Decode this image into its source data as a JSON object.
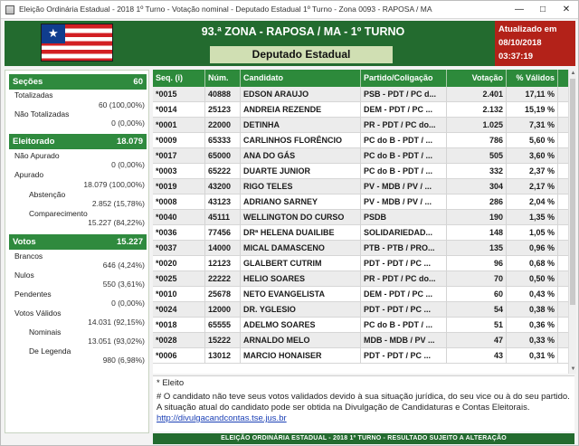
{
  "window": {
    "title": "Eleição Ordinária Estadual - 2018 1º Turno - Votação nominal - Deputado Estadual 1º Turno - Zona 0093 - RAPOSA / MA"
  },
  "header": {
    "title": "93.ª ZONA - RAPOSA / MA - 1º TURNO",
    "subtitle": "Deputado Estadual",
    "updated_label": "Atualizado em",
    "updated_date": "08/10/2018",
    "updated_time": "03:37:19"
  },
  "sidebar": {
    "secoes": {
      "label": "Seções",
      "total": "60",
      "totalizadas_label": "Totalizadas",
      "totalizadas_value": "60 (100,00%)",
      "nao_totalizadas_label": "Não Totalizadas",
      "nao_totalizadas_value": "0 (0,00%)"
    },
    "eleitorado": {
      "label": "Eleitorado",
      "total": "18.079",
      "nao_apurado_label": "Não Apurado",
      "nao_apurado_value": "0 (0,00%)",
      "apurado_label": "Apurado",
      "apurado_value": "18.079 (100,00%)",
      "abstencao_label": "Abstenção",
      "abstencao_value": "2.852 (15,78%)",
      "comparecimento_label": "Comparecimento",
      "comparecimento_value": "15.227 (84,22%)"
    },
    "votos": {
      "label": "Votos",
      "total": "15.227",
      "brancos_label": "Brancos",
      "brancos_value": "646 (4,24%)",
      "nulos_label": "Nulos",
      "nulos_value": "550 (3,61%)",
      "pendentes_label": "Pendentes",
      "pendentes_value": "0 (0,00%)",
      "validos_label": "Votos Válidos",
      "validos_value": "14.031 (92,15%)",
      "nominais_label": "Nominais",
      "nominais_value": "13.051 (93,02%)",
      "legenda_label": "De Legenda",
      "legenda_value": "980 (6,98%)"
    }
  },
  "table": {
    "headers": {
      "seq": "Seq. (i)",
      "num": "Núm.",
      "cand": "Candidato",
      "part": "Partido/Coligação",
      "vot": "Votação",
      "pct": "% Válidos"
    },
    "rows": [
      {
        "seq": "*0015",
        "num": "40888",
        "cand": "EDSON ARAUJO",
        "part": "PSB - PDT / PC d...",
        "vot": "2.401",
        "pct": "17,11 %"
      },
      {
        "seq": "*0014",
        "num": "25123",
        "cand": "ANDREIA REZENDE",
        "part": "DEM - PDT / PC ...",
        "vot": "2.132",
        "pct": "15,19 %"
      },
      {
        "seq": "*0001",
        "num": "22000",
        "cand": "DETINHA",
        "part": "PR - PDT / PC do...",
        "vot": "1.025",
        "pct": "7,31 %"
      },
      {
        "seq": "*0009",
        "num": "65333",
        "cand": "CARLINHOS FLORÊNCIO",
        "part": "PC do B - PDT / ...",
        "vot": "786",
        "pct": "5,60 %"
      },
      {
        "seq": "*0017",
        "num": "65000",
        "cand": "ANA DO GÁS",
        "part": "PC do B - PDT / ...",
        "vot": "505",
        "pct": "3,60 %"
      },
      {
        "seq": "*0003",
        "num": "65222",
        "cand": "DUARTE JUNIOR",
        "part": "PC do B - PDT / ...",
        "vot": "332",
        "pct": "2,37 %"
      },
      {
        "seq": "*0019",
        "num": "43200",
        "cand": "RIGO TELES",
        "part": "PV - MDB / PV / ...",
        "vot": "304",
        "pct": "2,17 %"
      },
      {
        "seq": "*0008",
        "num": "43123",
        "cand": "ADRIANO SARNEY",
        "part": "PV - MDB / PV / ...",
        "vot": "286",
        "pct": "2,04 %"
      },
      {
        "seq": "*0040",
        "num": "45111",
        "cand": "WELLINGTON DO CURSO",
        "part": "PSDB",
        "vot": "190",
        "pct": "1,35 %"
      },
      {
        "seq": "*0036",
        "num": "77456",
        "cand": "DRª HELENA DUAILIBE",
        "part": "SOLIDARIEDAD...",
        "vot": "148",
        "pct": "1,05 %"
      },
      {
        "seq": "*0037",
        "num": "14000",
        "cand": "MICAL DAMASCENO",
        "part": "PTB - PTB / PRO...",
        "vot": "135",
        "pct": "0,96 %"
      },
      {
        "seq": "*0020",
        "num": "12123",
        "cand": "GLALBERT CUTRIM",
        "part": "PDT - PDT / PC ...",
        "vot": "96",
        "pct": "0,68 %"
      },
      {
        "seq": "*0025",
        "num": "22222",
        "cand": "HELIO SOARES",
        "part": "PR - PDT / PC do...",
        "vot": "70",
        "pct": "0,50 %"
      },
      {
        "seq": "*0010",
        "num": "25678",
        "cand": "NETO EVANGELISTA",
        "part": "DEM - PDT / PC ...",
        "vot": "60",
        "pct": "0,43 %"
      },
      {
        "seq": "*0024",
        "num": "12000",
        "cand": "DR. YGLESIO",
        "part": "PDT - PDT / PC ...",
        "vot": "54",
        "pct": "0,38 %"
      },
      {
        "seq": "*0018",
        "num": "65555",
        "cand": "ADELMO SOARES",
        "part": "PC do B - PDT / ...",
        "vot": "51",
        "pct": "0,36 %"
      },
      {
        "seq": "*0028",
        "num": "15222",
        "cand": "ARNALDO MELO",
        "part": "MDB - MDB / PV ...",
        "vot": "47",
        "pct": "0,33 %"
      },
      {
        "seq": "*0006",
        "num": "13012",
        "cand": "MARCIO HONAISER",
        "part": "PDT - PDT / PC ...",
        "vot": "43",
        "pct": "0,31 %"
      }
    ]
  },
  "notes": {
    "eleito": "* Eleito",
    "text": "# O candidato não teve seus votos validados devido à sua situação jurídica, do seu vice ou à do seu partido. A situação atual do candidato pode ser obtida na Divulgação de Candidaturas e Contas Eleitorais.",
    "link": "http://divulgacandcontas.tse.jus.br"
  },
  "footer": {
    "text": "ELEIÇÃO ORDINÁRIA ESTADUAL - 2018 1º TURNO - RESULTADO SUJEITO A ALTERAÇÃO"
  },
  "colors": {
    "header_green": "#236b2f",
    "section_green": "#2f8a3e",
    "updated_red": "#b32219",
    "subtitle_bg": "#d0dfb3"
  },
  "icons": [
    "app-icon",
    "minimize-icon",
    "maximize-icon",
    "close-icon",
    "maranhao-flag"
  ]
}
